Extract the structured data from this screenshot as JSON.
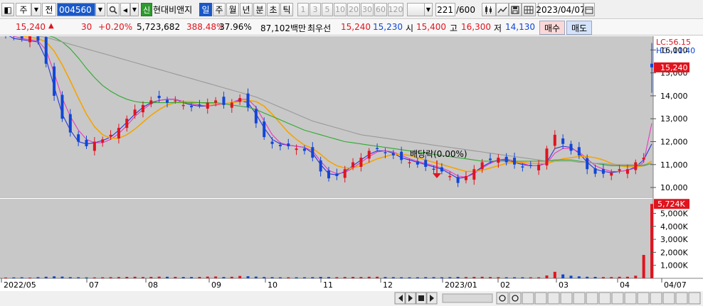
{
  "toolbar": {
    "icon_chart_glyph": "◧",
    "market": "주",
    "dropdown_glyph": "▼",
    "mode": "전",
    "code": "004560",
    "speaker_glyph": "◂",
    "new_badge": "신",
    "stock_name": "현대비앤지",
    "periods": [
      "일",
      "주",
      "월",
      "년",
      "분",
      "초",
      "틱"
    ],
    "period_selected": "일",
    "intervals": [
      "1",
      "3",
      "5",
      "10",
      "20",
      "30",
      "60",
      "120"
    ],
    "count_value": "221",
    "count_total": "/600",
    "date": "2023/04/07"
  },
  "info": {
    "price": "15,240",
    "change_arrow": "▲",
    "change": "30",
    "change_pct": "+0.20%",
    "volume": "5,723,682",
    "volume_ratio": "388.48%",
    "turnover": "37.96%",
    "amount": "87,102백만",
    "best_quote_label": "최우선",
    "best_ask": "15,240",
    "best_bid": "15,230",
    "open_label": "시",
    "open": "15,400",
    "high_label": "고",
    "high": "16,300",
    "low_label": "저",
    "low": "14,130",
    "buy_label": "매수",
    "sell_label": "매도"
  },
  "chart_data": {
    "type": "candlestick",
    "legend_lc": "LC:56.15",
    "legend_hc": "HC:-11.40",
    "price_axis_ticks": [
      "16,000",
      "15,000",
      "14,000",
      "13,000",
      "12,000",
      "11,000",
      "10,000"
    ],
    "price_axis_values": [
      16000,
      15000,
      14000,
      13000,
      12000,
      11000,
      10000
    ],
    "current_price_label": "15,240",
    "current_price": 15240,
    "volume_axis_ticks": [
      "5,000K",
      "4,000K",
      "3,000K",
      "2,000K",
      "1,000K"
    ],
    "volume_axis_values": [
      5000,
      4000,
      3000,
      2000,
      1000
    ],
    "current_volume_label": "5,724K",
    "current_volume": 5724,
    "x_labels": [
      "2022/05",
      "07",
      "08",
      "09",
      "10",
      "11",
      "12",
      "2023/01",
      "02",
      "03",
      "04",
      "04/07"
    ],
    "annotation": "배당락(0.00%)",
    "ylim": [
      9600,
      16600
    ],
    "volume_ylim": [
      0,
      5900
    ],
    "moving_averages": [
      {
        "color": "#2a35d8",
        "values": [
          16700,
          16500,
          16450,
          16400,
          16350,
          15600,
          14400,
          13200,
          12500,
          12000,
          11900,
          11950,
          12050,
          12200,
          12500,
          12850,
          13200,
          13500,
          13700,
          13800,
          13850,
          13850,
          13700,
          13600,
          13550,
          13550,
          13600,
          13650,
          13700,
          13800,
          13700,
          13200,
          12600,
          12100,
          11900,
          11850,
          11800,
          11750,
          11500,
          11000,
          10600,
          10550,
          10700,
          10950,
          11200,
          11450,
          11600,
          11600,
          11500,
          11300,
          11200,
          11100,
          11000,
          10900,
          10800,
          10600,
          10400,
          10450,
          10650,
          10900,
          11100,
          11200,
          11200,
          11100,
          11000,
          10950,
          10950,
          11100,
          11700,
          11800,
          11750,
          11500,
          11100,
          10800,
          10700,
          10650,
          10700,
          10750,
          10900,
          11200,
          11900
        ]
      },
      {
        "color": "#e83ac0",
        "values": [
          16700,
          16600,
          16500,
          16450,
          16400,
          16000,
          15000,
          13900,
          13100,
          12500,
          12100,
          11950,
          11950,
          12100,
          12350,
          12700,
          13100,
          13400,
          13650,
          13800,
          13850,
          13850,
          13750,
          13650,
          13600,
          13550,
          13600,
          13650,
          13700,
          13850,
          13850,
          13500,
          12900,
          12300,
          11950,
          11850,
          11800,
          11750,
          11600,
          11150,
          10750,
          10600,
          10650,
          10850,
          11100,
          11350,
          11550,
          11600,
          11550,
          11400,
          11250,
          11150,
          11050,
          10950,
          10850,
          10700,
          10500,
          10450,
          10600,
          10850,
          11050,
          11200,
          11250,
          11150,
          11050,
          10950,
          10950,
          11050,
          11500,
          11700,
          11700,
          11550,
          11250,
          10950,
          10800,
          10700,
          10700,
          10750,
          10850,
          11100,
          12800
        ]
      },
      {
        "color": "#f5a400",
        "values": [
          16700,
          16650,
          16600,
          16550,
          16500,
          16350,
          15950,
          15350,
          14650,
          13900,
          13200,
          12650,
          12300,
          12150,
          12150,
          12300,
          12550,
          12850,
          13150,
          13400,
          13600,
          13700,
          13750,
          13750,
          13700,
          13650,
          13650,
          13650,
          13700,
          13750,
          13800,
          13750,
          13550,
          13200,
          12800,
          12400,
          12100,
          11850,
          11700,
          11450,
          11150,
          10950,
          10850,
          10850,
          10950,
          11100,
          11250,
          11350,
          11450,
          11450,
          11400,
          11300,
          11200,
          11100,
          11000,
          10900,
          10800,
          10700,
          10700,
          10750,
          10850,
          10950,
          11050,
          11100,
          11100,
          11050,
          11050,
          11050,
          11150,
          11250,
          11300,
          11350,
          11350,
          11300,
          11200,
          11050,
          10950,
          10900,
          10900,
          10950,
          11150
        ]
      },
      {
        "color": "#2eaa2e",
        "values": [
          16900,
          16850,
          16800,
          16750,
          16700,
          16650,
          16550,
          16350,
          16050,
          15650,
          15200,
          14800,
          14450,
          14200,
          14000,
          13850,
          13750,
          13700,
          13700,
          13700,
          13700,
          13700,
          13700,
          13700,
          13700,
          13700,
          13700,
          13650,
          13600,
          13550,
          13500,
          13400,
          13250,
          13100,
          12950,
          12800,
          12650,
          12500,
          12400,
          12300,
          12200,
          12100,
          12000,
          11950,
          11900,
          11850,
          11800,
          11750,
          11700,
          11650,
          11600,
          11550,
          11500,
          11450,
          11400,
          11350,
          11300,
          11250,
          11200,
          11150,
          11150,
          11150,
          11150,
          11150,
          11150,
          11150,
          11150,
          11150,
          11200,
          11200,
          11200,
          11150,
          11100,
          11050,
          11000,
          10950,
          10950,
          10950,
          10950,
          10950,
          11050
        ]
      },
      {
        "color": "#999999",
        "values": [
          16800,
          16750,
          16700,
          16650,
          16600,
          16550,
          16450,
          16350,
          16250,
          16150,
          16050,
          15950,
          15850,
          15750,
          15650,
          15550,
          15450,
          15350,
          15250,
          15150,
          15050,
          14950,
          14850,
          14750,
          14650,
          14550,
          14450,
          14350,
          14250,
          14150,
          14050,
          13950,
          13800,
          13650,
          13500,
          13350,
          13200,
          13050,
          12900,
          12800,
          12700,
          12600,
          12500,
          12400,
          12300,
          12250,
          12200,
          12150,
          12100,
          12050,
          12000,
          11950,
          11900,
          11850,
          11800,
          11750,
          11700,
          11650,
          11600,
          11550,
          11500,
          11450,
          11400,
          11350,
          11300,
          11250,
          11200,
          11150,
          11150,
          11150,
          11150,
          11100,
          11100,
          11050,
          11050,
          11000,
          11000,
          11000,
          11000,
          11000,
          11050
        ]
      }
    ],
    "candles_close": [
      16700,
      16600,
      16500,
      16600,
      16400,
      15400,
      14000,
      13000,
      12400,
      12000,
      11800,
      12000,
      12100,
      12300,
      12600,
      13000,
      13400,
      13600,
      13800,
      13900,
      13700,
      13800,
      13600,
      13500,
      13600,
      13700,
      13800,
      13600,
      13700,
      13900,
      13500,
      12800,
      12200,
      11900,
      11800,
      11800,
      11700,
      11600,
      11300,
      10700,
      10400,
      10500,
      10800,
      11100,
      11300,
      11600,
      11700,
      11500,
      11400,
      11200,
      11100,
      11000,
      10900,
      10800,
      10700,
      10500,
      10200,
      10500,
      10800,
      11100,
      11200,
      11300,
      11100,
      11000,
      10900,
      10950,
      11000,
      11700,
      12300,
      11900,
      11600,
      11400,
      10800,
      10600,
      10600,
      10650,
      10800,
      10800,
      11100,
      11300,
      15240
    ],
    "candles_volume": [
      60,
      70,
      80,
      60,
      90,
      120,
      150,
      130,
      90,
      80,
      70,
      70,
      80,
      90,
      100,
      110,
      120,
      100,
      110,
      130,
      120,
      110,
      100,
      100,
      110,
      130,
      140,
      100,
      120,
      180,
      160,
      130,
      100,
      90,
      80,
      80,
      80,
      80,
      90,
      110,
      100,
      90,
      100,
      110,
      100,
      120,
      120,
      100,
      90,
      80,
      80,
      80,
      90,
      90,
      80,
      90,
      110,
      100,
      110,
      120,
      100,
      90,
      80,
      80,
      80,
      80,
      80,
      220,
      500,
      300,
      200,
      150,
      120,
      110,
      100,
      100,
      120,
      120,
      200,
      1800,
      5724
    ]
  }
}
